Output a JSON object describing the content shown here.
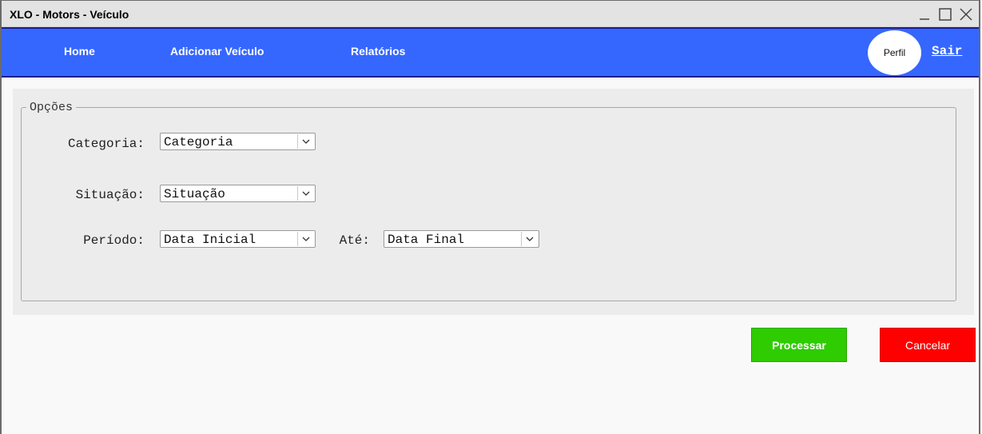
{
  "window": {
    "title": "XLO - Motors - Veículo",
    "controls": [
      "minimize-icon",
      "maximize-icon",
      "close-icon"
    ]
  },
  "nav": {
    "items": [
      {
        "label": "Home"
      },
      {
        "label": "Adicionar Veículo"
      },
      {
        "label": "Relatórios"
      }
    ],
    "perfil": "Perfil",
    "sair": "Sair"
  },
  "options": {
    "legend": "Opções",
    "categoria": {
      "label": "Categoria:",
      "value": "Categoria"
    },
    "situacao": {
      "label": "Situação:",
      "value": "Situação"
    },
    "periodo": {
      "label": "Período:",
      "value": "Data Inicial"
    },
    "ate": {
      "label": "Até:",
      "value": "Data Final"
    }
  },
  "actions": {
    "processar": "Processar",
    "cancelar": "Cancelar"
  },
  "colors": {
    "navbar": "#3567ff",
    "processar": "#2ecc00",
    "cancelar": "#ff0000"
  }
}
